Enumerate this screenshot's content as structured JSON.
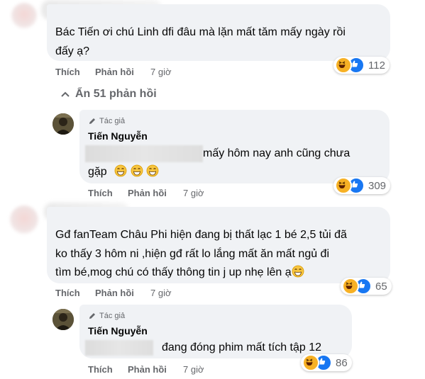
{
  "comment1": {
    "text_line1": "Bác Tiến ơi chú Linh dfi đâu mà lặn mất tăm mấy ngày rồi",
    "text_line2": "đấy ạ?",
    "like_label": "Thích",
    "reply_label": "Phản hồi",
    "time": "7 giờ",
    "reaction_count": "112"
  },
  "hidden_replies": {
    "label": "Ẩn 51 phản hồi"
  },
  "reply1": {
    "author_tag": "Tác giả",
    "author_name": "Tiến Nguyễn",
    "text_line1": "mấy hôm nay anh cũng chưa",
    "text_line2": "gặp",
    "like_label": "Thích",
    "reply_label": "Phản hồi",
    "time": "7 giờ",
    "reaction_count": "309"
  },
  "comment2": {
    "text_line1": "Gđ fanTeam Châu Phi hiện đang bị thất lạc 1 bé 2,5 tủi đã",
    "text_line2": "ko thấy 3 hôm ni ,hiện gđ rất lo lắng mất ăn mất ngủ đi",
    "text_line3": "tìm bé,mog chú có thấy thông tin j up nhẹ lên ạ",
    "like_label": "Thích",
    "reply_label": "Phản hồi",
    "time": "7 giờ",
    "reaction_count": "65"
  },
  "reply2": {
    "author_tag": "Tác giả",
    "author_name": "Tiến Nguyễn",
    "text_line1": "đang đóng phim mất tích tập 12",
    "like_label": "Thích",
    "reply_label": "Phản hồi",
    "time": "7 giờ",
    "reaction_count": "86"
  },
  "colors": {
    "bubble": "#f0f2f5",
    "meta_text": "#65676b",
    "like_blue": "#1877f2",
    "haha_yellow": "#f7b125"
  }
}
